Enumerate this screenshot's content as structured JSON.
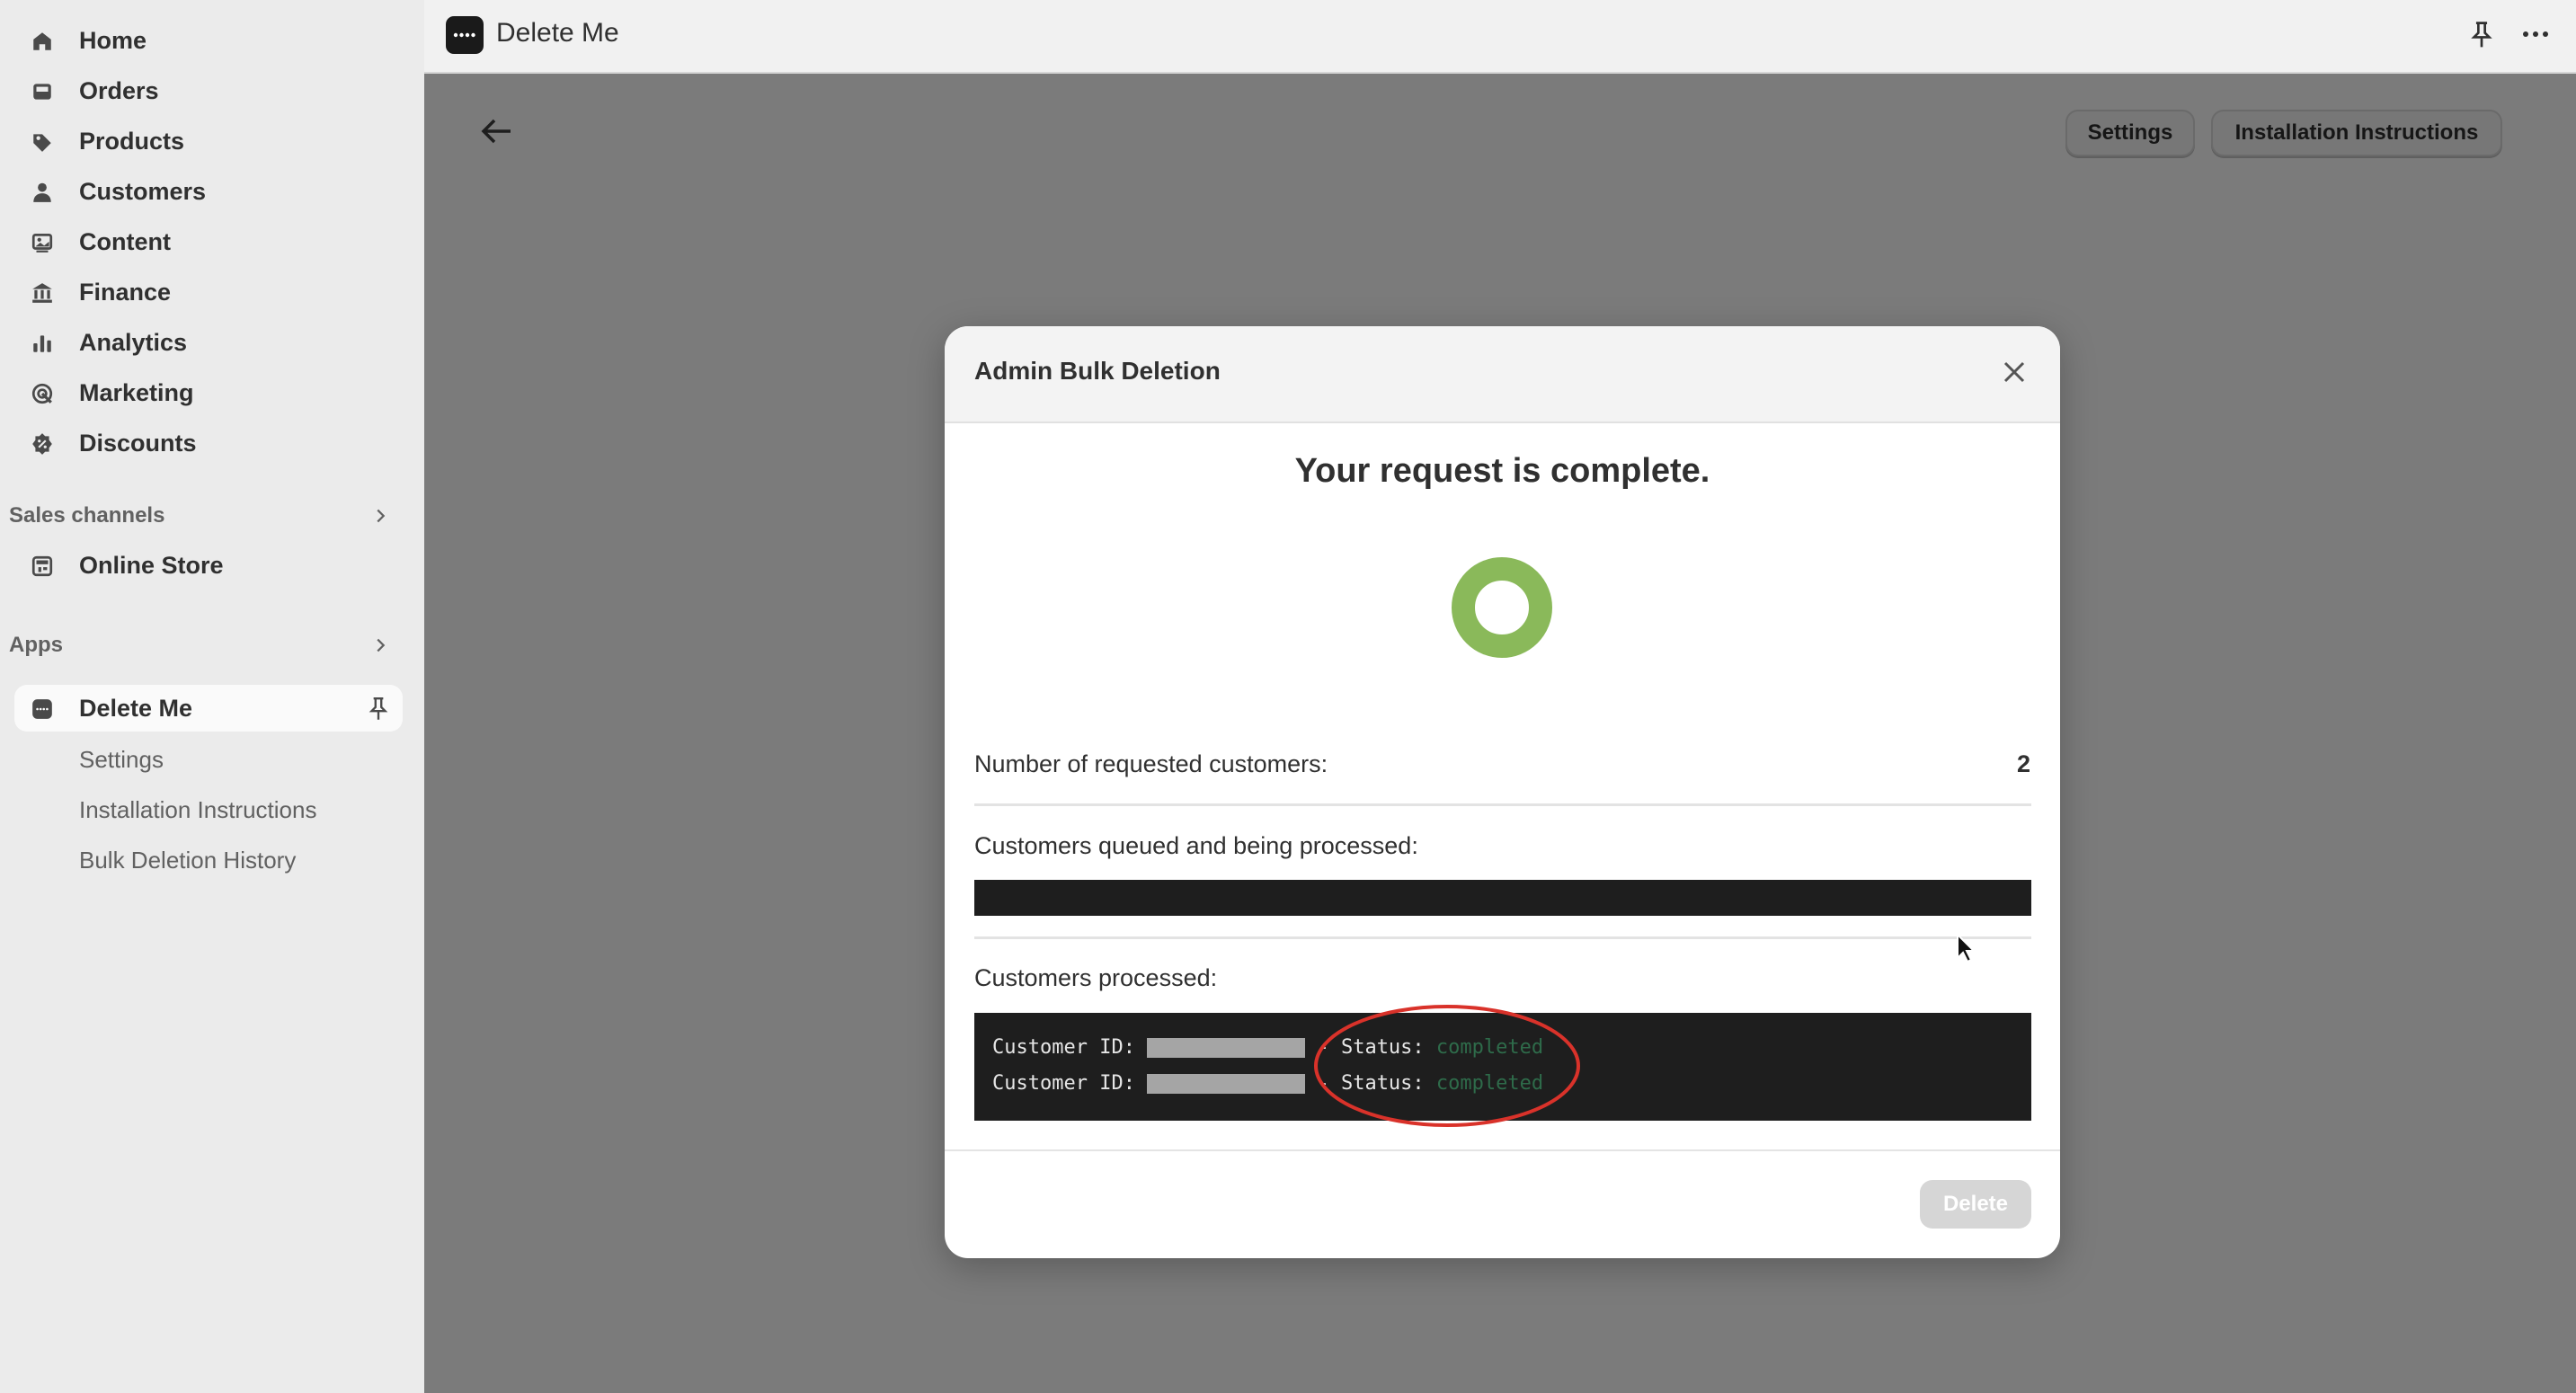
{
  "sidebar": {
    "items": [
      {
        "label": "Home",
        "icon": "home-icon"
      },
      {
        "label": "Orders",
        "icon": "inbox-icon"
      },
      {
        "label": "Products",
        "icon": "tag-icon"
      },
      {
        "label": "Customers",
        "icon": "person-icon"
      },
      {
        "label": "Content",
        "icon": "image-icon"
      },
      {
        "label": "Finance",
        "icon": "bank-icon"
      },
      {
        "label": "Analytics",
        "icon": "bar-chart-icon"
      },
      {
        "label": "Marketing",
        "icon": "target-icon"
      },
      {
        "label": "Discounts",
        "icon": "discount-icon"
      }
    ],
    "sales_channels": {
      "label": "Sales channels",
      "items": [
        {
          "label": "Online Store",
          "icon": "store-icon"
        }
      ]
    },
    "apps": {
      "label": "Apps",
      "active": {
        "label": "Delete Me",
        "icon": "app-icon"
      },
      "sub_items": [
        "Settings",
        "Installation Instructions",
        "Bulk Deletion History"
      ]
    }
  },
  "topbar": {
    "title": "Delete Me"
  },
  "page": {
    "settings_label": "Settings",
    "instructions_label": "Installation Instructions"
  },
  "modal": {
    "title": "Admin Bulk Deletion",
    "headline": "Your request is complete.",
    "requested_label": "Number of requested customers:",
    "requested_value": "2",
    "queued_label": "Customers queued and being processed:",
    "processed_label": "Customers processed:",
    "processed_rows": [
      {
        "id_label": "Customer ID:",
        "sep": "-",
        "status_label": "Status:",
        "status": "completed"
      },
      {
        "id_label": "Customer ID:",
        "sep": "-",
        "status_label": "Status:",
        "status": "completed"
      }
    ],
    "delete_label": "Delete"
  },
  "colors": {
    "ring_green": "#8ab95a",
    "annotation_red": "#d9322a",
    "status_green": "#2e6b4a",
    "terminal_bg": "#1e1e1e"
  }
}
